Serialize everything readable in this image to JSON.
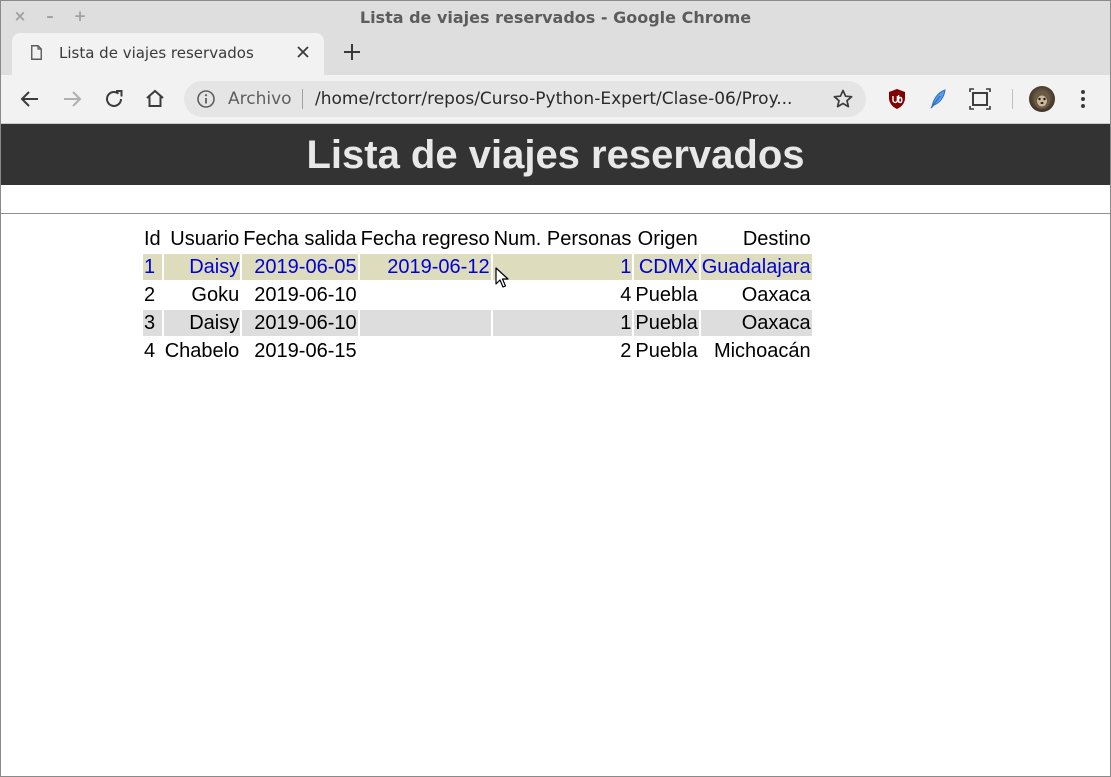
{
  "window": {
    "title": "Lista de viajes reservados - Google Chrome",
    "controls": {
      "close": "×",
      "minimize": "–",
      "maximize": "+"
    }
  },
  "tab": {
    "title": "Lista de viajes reservados",
    "close_icon": "close-icon",
    "page_icon": "page-icon"
  },
  "new_tab_icon": "plus-icon",
  "toolbar": {
    "back_icon": "back-arrow-icon",
    "forward_icon": "forward-arrow-icon",
    "reload_icon": "reload-icon",
    "home_icon": "home-icon",
    "menu_icon": "kebab-menu-icon"
  },
  "omnibox": {
    "info_icon": "info-icon",
    "scheme_label": "Archivo",
    "url": "/home/rctorr/repos/Curso-Python-Expert/Clase-06/Proy...",
    "bookmark_icon": "star-icon"
  },
  "extensions": [
    {
      "name": "ublock-origin-icon",
      "color": "#800000"
    },
    {
      "name": "feather-extension-icon",
      "color": "#3b8be0"
    },
    {
      "name": "screen-capture-icon",
      "color": "#4a4a4a"
    }
  ],
  "page": {
    "heading": "Lista de viajes reservados",
    "header_bg": "#333333",
    "table": {
      "columns": [
        "Id",
        "Usuario",
        "Fecha salida",
        "Fecha regreso",
        "Num. Personas",
        "Origen",
        "Destino"
      ],
      "rows": [
        {
          "id": "1",
          "usuario": "Daisy",
          "fecha_salida": "2019-06-05",
          "fecha_regreso": "2019-06-12",
          "num_personas": "1",
          "origen": "CDMX",
          "destino": "Guadalajara"
        },
        {
          "id": "2",
          "usuario": "Goku",
          "fecha_salida": "2019-06-10",
          "fecha_regreso": "",
          "num_personas": "4",
          "origen": "Puebla",
          "destino": "Oaxaca"
        },
        {
          "id": "3",
          "usuario": "Daisy",
          "fecha_salida": "2019-06-10",
          "fecha_regreso": "",
          "num_personas": "1",
          "origen": "Puebla",
          "destino": "Oaxaca"
        },
        {
          "id": "4",
          "usuario": "Chabelo",
          "fecha_salida": "2019-06-15",
          "fecha_regreso": "",
          "num_personas": "2",
          "origen": "Puebla",
          "destino": "Michoacán"
        }
      ],
      "hover_row_bg": "#dddcbc",
      "hover_row_text": "#0000d6",
      "stripe_bg": "#dddddd"
    }
  }
}
